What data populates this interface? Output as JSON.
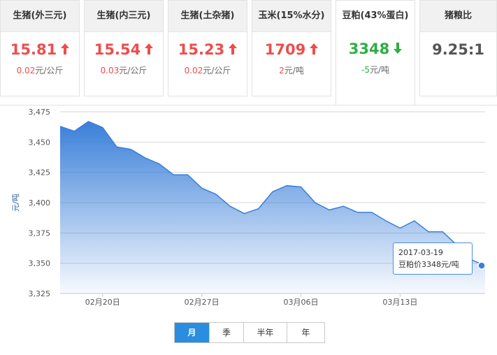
{
  "cards": [
    {
      "name": "生猪(外三元)",
      "value": "15.81",
      "trend": "up",
      "change": "0.02",
      "unit": "元/公斤"
    },
    {
      "name": "生猪(内三元)",
      "value": "15.54",
      "trend": "up",
      "change": "0.03",
      "unit": "元/公斤"
    },
    {
      "name": "生猪(土杂猪)",
      "value": "15.23",
      "trend": "up",
      "change": "0.02",
      "unit": "元/公斤"
    },
    {
      "name": "玉米(15%水分)",
      "value": "1709",
      "trend": "up",
      "change": "2",
      "unit": "元/吨"
    },
    {
      "name": "豆粕(43%蛋白)",
      "value": "3348",
      "trend": "down",
      "change": "-5",
      "unit": "元/吨"
    },
    {
      "name": "猪粮比",
      "value": "9.25:1",
      "trend": "none",
      "change": "",
      "unit": ""
    }
  ],
  "active_card": 4,
  "colors": {
    "up": "#ee4d4d",
    "down": "#2eae44",
    "accent": "#2a8de0",
    "series": "#3a7fd9"
  },
  "tooltip": {
    "date": "2017-03-19",
    "text": "豆粕价3348元/吨"
  },
  "range_tabs": [
    {
      "label": "月",
      "active": true
    },
    {
      "label": "季",
      "active": false
    },
    {
      "label": "半年",
      "active": false
    },
    {
      "label": "年",
      "active": false
    }
  ],
  "chart_data": {
    "type": "area",
    "ylabel": "元/吨",
    "ylim": [
      3325,
      3475
    ],
    "yticks": [
      "3,325",
      "3,350",
      "3,375",
      "3,400",
      "3,425",
      "3,450",
      "3,475"
    ],
    "xtick_labels": [
      {
        "date": "2017-02-20",
        "label": "02月20日"
      },
      {
        "date": "2017-02-27",
        "label": "02月27日"
      },
      {
        "date": "2017-03-06",
        "label": "03月06日"
      },
      {
        "date": "2017-03-13",
        "label": "03月13日"
      }
    ],
    "grid": true,
    "series": [
      {
        "x": [
          "2017-02-17",
          "2017-02-18",
          "2017-02-19",
          "2017-02-20",
          "2017-02-21",
          "2017-02-22",
          "2017-02-23",
          "2017-02-24",
          "2017-02-25",
          "2017-02-26",
          "2017-02-27",
          "2017-02-28",
          "2017-03-01",
          "2017-03-02",
          "2017-03-03",
          "2017-03-04",
          "2017-03-05",
          "2017-03-06",
          "2017-03-07",
          "2017-03-08",
          "2017-03-09",
          "2017-03-10",
          "2017-03-11",
          "2017-03-12",
          "2017-03-13",
          "2017-03-14",
          "2017-03-15",
          "2017-03-16",
          "2017-03-17",
          "2017-03-18",
          "2017-03-19"
        ],
        "values": [
          3463,
          3459,
          3467,
          3462,
          3446,
          3444,
          3437,
          3432,
          3423,
          3423,
          3412,
          3407,
          3397,
          3391,
          3395,
          3409,
          3414,
          3413,
          3400,
          3394,
          3397,
          3392,
          3392,
          3385,
          3379,
          3385,
          3376,
          3376,
          3365,
          3353,
          3348
        ]
      }
    ]
  }
}
